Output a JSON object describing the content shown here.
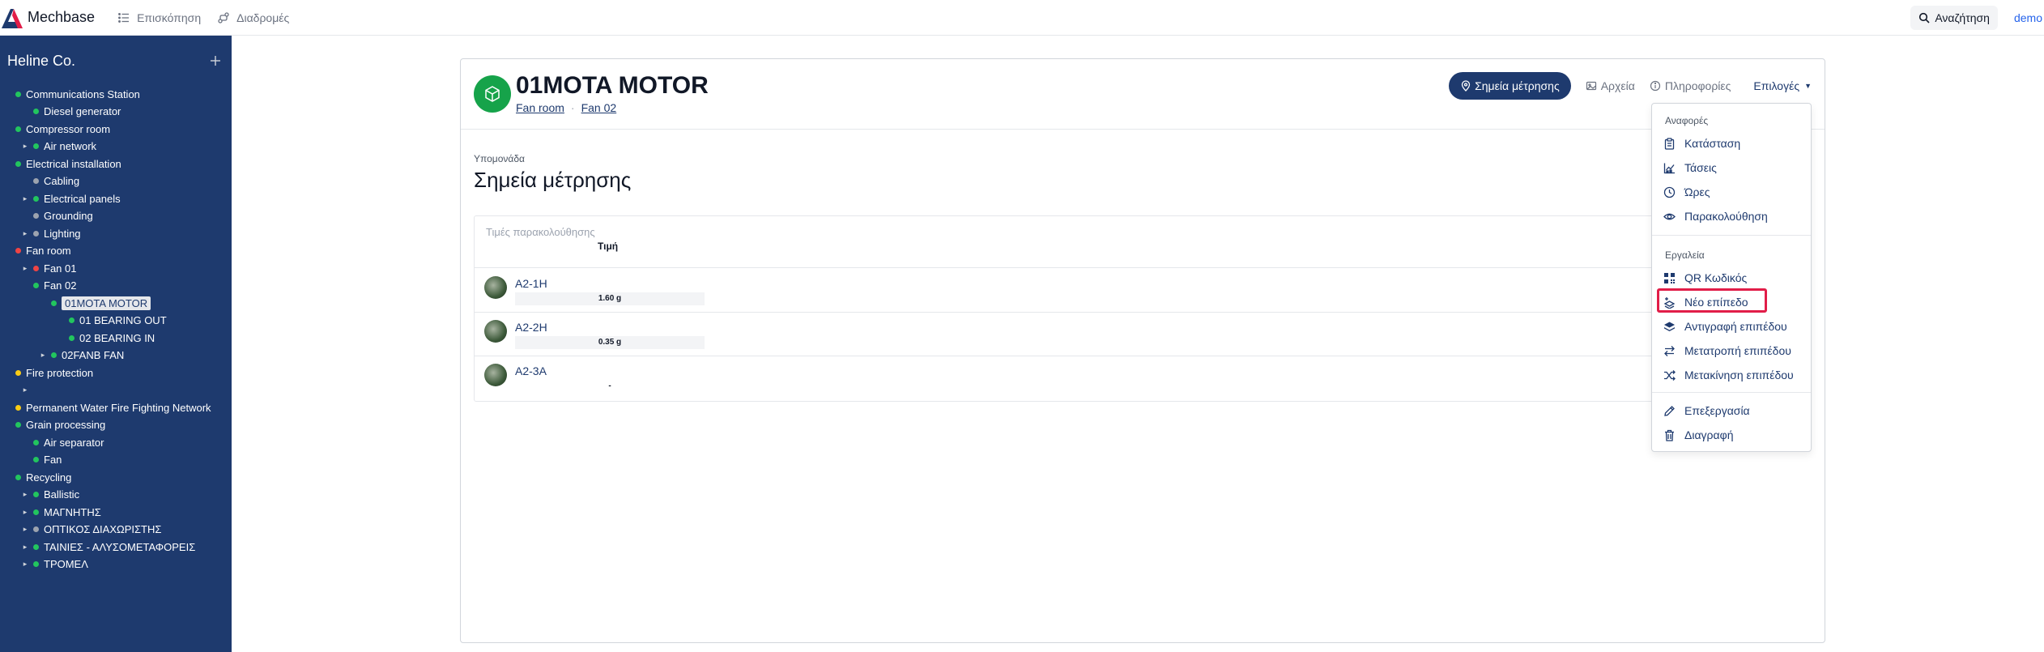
{
  "app": {
    "name": "Mechbase"
  },
  "topnav": [
    {
      "label": "Επισκόπηση",
      "icon": "list-icon"
    },
    {
      "label": "Διαδρομές",
      "icon": "route-icon"
    }
  ],
  "search": {
    "label": "Αναζήτηση"
  },
  "user": {
    "name": "demo"
  },
  "sidebar": {
    "org": "Heline Co.",
    "tree": [
      {
        "label": "Communications Station",
        "dot": "green",
        "caret": "",
        "level": 0
      },
      {
        "label": "Diesel generator",
        "dot": "green",
        "caret": "",
        "level": 1
      },
      {
        "label": "Compressor room",
        "dot": "green",
        "caret": "",
        "level": 0
      },
      {
        "label": "Air network",
        "dot": "green",
        "caret": "▸",
        "level": 1
      },
      {
        "label": "Electrical installation",
        "dot": "green",
        "caret": "",
        "level": 0
      },
      {
        "label": "Cabling",
        "dot": "gray",
        "caret": "",
        "level": 1
      },
      {
        "label": "Electrical panels",
        "dot": "green",
        "caret": "▸",
        "level": 1
      },
      {
        "label": "Grounding",
        "dot": "gray",
        "caret": "",
        "level": 1
      },
      {
        "label": "Lighting",
        "dot": "gray",
        "caret": "▸",
        "level": 1
      },
      {
        "label": "Fan room",
        "dot": "red",
        "caret": "",
        "level": 0
      },
      {
        "label": "Fan 01",
        "dot": "red",
        "caret": "▸",
        "level": 1
      },
      {
        "label": "Fan 02",
        "dot": "green",
        "caret": "",
        "level": 1
      },
      {
        "label": "01MOTA MOTOR",
        "dot": "green",
        "caret": "",
        "level": 2
      },
      {
        "label": "01 BEARING OUT",
        "dot": "green",
        "caret": "",
        "level": 3
      },
      {
        "label": "02 BEARING IN",
        "dot": "green",
        "caret": "",
        "level": 3
      },
      {
        "label": "02FANB FAN",
        "dot": "green",
        "caret": "▸",
        "level": 2
      },
      {
        "label": "Fire protection",
        "dot": "yellow",
        "caret": "",
        "level": 0
      },
      {
        "label": "",
        "dot": "",
        "caret": "▸",
        "level": 1
      },
      {
        "label": "Permanent Water Fire Fighting Network",
        "dot": "yellow",
        "caret": "",
        "level": 0
      },
      {
        "label": "Grain processing",
        "dot": "green",
        "caret": "",
        "level": 0
      },
      {
        "label": "Air separator",
        "dot": "green",
        "caret": "",
        "level": 1
      },
      {
        "label": "Fan",
        "dot": "green",
        "caret": "",
        "level": 1
      },
      {
        "label": "Recycling",
        "dot": "green",
        "caret": "",
        "level": 0
      },
      {
        "label": "Ballistic",
        "dot": "green",
        "caret": "▸",
        "level": 1
      },
      {
        "label": "ΜΑΓΝΗΤΗΣ",
        "dot": "green",
        "caret": "▸",
        "level": 1
      },
      {
        "label": "ΟΠΤΙΚΟΣ ΔΙΑΧΩΡΙΣΤΗΣ",
        "dot": "gray",
        "caret": "▸",
        "level": 1
      },
      {
        "label": "ΤΑΙΝΙΕΣ - ΑΛΥΣΟΜΕΤΑΦΟΡΕΙΣ",
        "dot": "green",
        "caret": "▸",
        "level": 1
      },
      {
        "label": "ΤΡΟΜΕΛ",
        "dot": "green",
        "caret": "▸",
        "level": 1
      }
    ],
    "selected_index": 12
  },
  "asset": {
    "title": "01MOTA MOTOR",
    "breadcrumb": [
      "Fan room",
      "Fan 02"
    ]
  },
  "actions": {
    "primary": "Σημεία μέτρησης",
    "files": "Αρχεία",
    "info": "Πληροφορίες",
    "options": "Επιλογές"
  },
  "section": {
    "label": "Υπομονάδα",
    "title": "Σημεία μέτρησης"
  },
  "table": {
    "header_label": "Τιμές παρακολούθησης",
    "value_header": "Τιμή",
    "rows": [
      {
        "name": "A2-1H",
        "value": "1.60 g"
      },
      {
        "name": "A2-2H",
        "value": "0.35 g"
      },
      {
        "name": "A2-3A",
        "value": "-"
      }
    ]
  },
  "menu": {
    "reports_label": "Αναφορές",
    "reports": [
      "Κατάσταση",
      "Τάσεις",
      "Ώρες",
      "Παρακολούθηση"
    ],
    "tools_label": "Εργαλεία",
    "tools": [
      "QR Κωδικός",
      "Νέο επίπεδο",
      "Αντιγραφή επιπέδου",
      "Μετατροπή επιπέδου",
      "Μετακίνηση επιπέδου"
    ],
    "edit": [
      "Επεξεργασία",
      "Διαγραφή"
    ],
    "highlighted": "Νέο επίπεδο"
  },
  "colors": {
    "sidebar_bg": "#1e3a6e",
    "primary": "#1e3a6e",
    "asset_icon_bg": "#16a34a",
    "highlight": "#e11d48"
  }
}
